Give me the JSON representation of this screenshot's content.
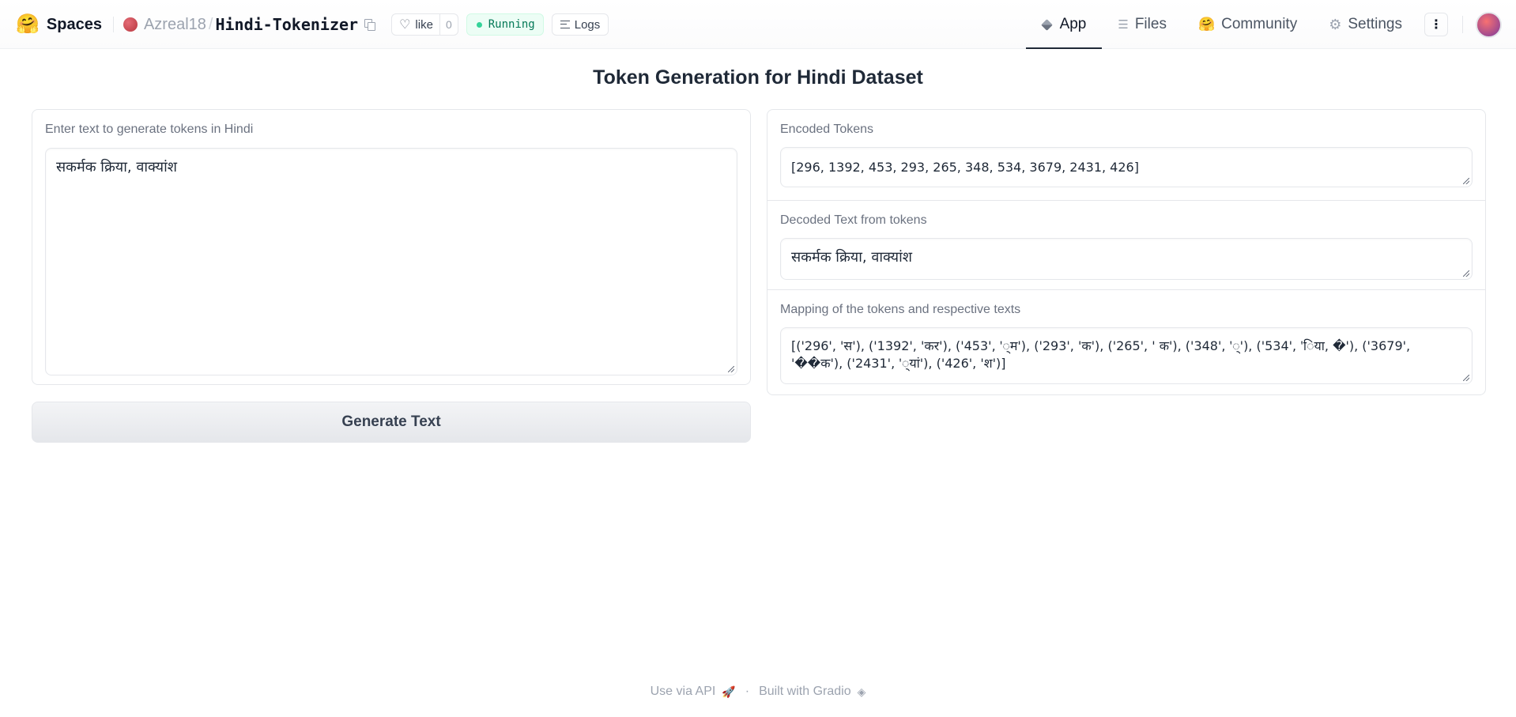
{
  "header": {
    "brand": "Spaces",
    "owner": "Azreal18",
    "separator": "/",
    "repo": "Hindi-Tokenizer",
    "like_label": "like",
    "like_count": "0",
    "status": "Running",
    "logs_label": "Logs",
    "status_color": "#047857",
    "tabs": [
      {
        "label": "App",
        "icon": "cube-icon",
        "active": true
      },
      {
        "label": "Files",
        "icon": "files-icon",
        "active": false
      },
      {
        "label": "Community",
        "icon": "hug-icon",
        "active": false
      },
      {
        "label": "Settings",
        "icon": "gear-icon",
        "active": false
      }
    ]
  },
  "main": {
    "title": "Token Generation for Hindi Dataset",
    "input": {
      "label": "Enter text to generate tokens in Hindi",
      "value": "सकर्मक क्रिया, वाक्यांश"
    },
    "generate_button": "Generate Text",
    "outputs": {
      "encoded": {
        "label": "Encoded Tokens",
        "value": "[296, 1392, 453, 293, 265, 348, 534, 3679, 2431, 426]"
      },
      "decoded": {
        "label": "Decoded Text from tokens",
        "value": "सकर्मक क्रिया, वाक्यांश"
      },
      "mapping": {
        "label": "Mapping of the tokens and respective texts",
        "value": "[('296', 'स'), ('1392', 'कर'), ('453', '्म'), ('293', 'क'), ('265', ' क'), ('348', '्'), ('534', 'िया, �'), ('3679', '��क'), ('2431', '्यां'), ('426', 'श')]"
      }
    }
  },
  "footer": {
    "api": "Use via API",
    "dot": "·",
    "built": "Built with Gradio"
  }
}
